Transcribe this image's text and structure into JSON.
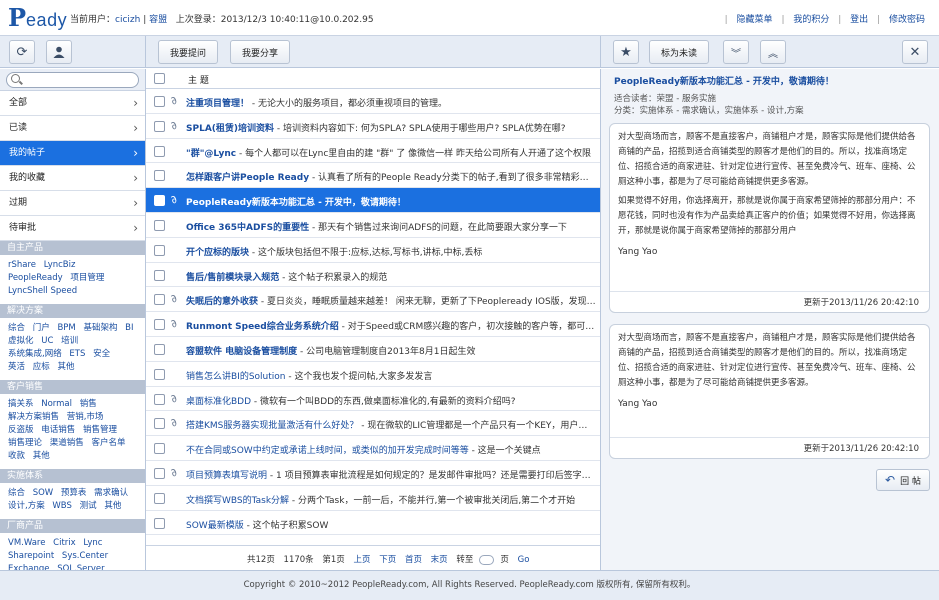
{
  "header": {
    "logo_p": "P",
    "logo_text": "eady",
    "current_user_label": "当前用户：",
    "user_name": "cicizh",
    "user_sep": " | ",
    "user_company": "容盟",
    "last_login_label": "上次登录：",
    "last_login_value": "2013/12/3 10:40:11@10.0.202.95",
    "links": [
      "隐藏菜单",
      "我的积分",
      "登出",
      "修改密码"
    ]
  },
  "toolbar": {
    "ask_label": "我要提问",
    "share_label": "我要分享",
    "mark_unread_label": "标为未读"
  },
  "sidebar": {
    "search_placeholder": "",
    "nav": [
      {
        "label": "全部"
      },
      {
        "label": "已读"
      },
      {
        "label": "我的帖子",
        "active": true
      },
      {
        "label": "我的收藏"
      },
      {
        "label": "过期"
      },
      {
        "label": "待审批"
      }
    ],
    "sections": [
      {
        "title": "自主产品",
        "items": [
          "rShare",
          "LyncBiz",
          "PeopleReady",
          "项目管理",
          "LyncShell Speed"
        ]
      },
      {
        "title": "解决方案",
        "items": [
          "综合",
          "门户",
          "BPM",
          "基础架构",
          "BI",
          "虚拟化",
          "UC",
          "培训",
          "系统集成,网络",
          "ETS",
          "安全",
          "英活",
          "应标",
          "其他"
        ]
      },
      {
        "title": "客户销售",
        "items": [
          "搞关系",
          "Normal",
          "销售",
          "解决方案销售",
          "营销,市场",
          "反盗版",
          "电话销售",
          "销售管理",
          "销售理论",
          "渠道销售",
          "客户名单",
          "收款",
          "其他"
        ]
      },
      {
        "title": "实施体系",
        "items": [
          "综合",
          "SOW",
          "预算表",
          "需求确认",
          "设计,方案",
          "WBS",
          "测试",
          "其他"
        ]
      },
      {
        "title": "厂商产品",
        "items": [
          "VM.Ware",
          "Citrix",
          "Lync",
          "Sharepoint",
          "Sys.Center",
          "Exchange",
          "SQL.Server",
          "Sophos",
          "Symantec",
          "Win.Server"
        ]
      }
    ]
  },
  "list": {
    "header_label": "主 题",
    "rows": [
      {
        "attach": true,
        "title": "注重项目管理！",
        "summary": " - 无论大小的服务项目，都必须重视项目的管理。"
      },
      {
        "attach": true,
        "title": "SPLA(租赁)培训资料",
        "summary": " - 培训资料内容如下: 何为SPLA? SPLA使用于哪些用户? SPLA优势在哪?"
      },
      {
        "attach": false,
        "title": "\"群\"@Lync",
        "summary": " - 每个人都可以在Lync里自由的建 \"群\" 了 像微信一样 昨天给公司所有人开通了这个权限"
      },
      {
        "attach": false,
        "title": "怎样跟客户讲People Ready",
        "summary": " - 认真看了所有的People Ready分类下的帖子,看到了很多非常精彩的功能说..."
      },
      {
        "attach": true,
        "title": "PeopleReady新版本功能汇总 - 开发中，敬请期待！",
        "summary": "",
        "selected": true
      },
      {
        "attach": false,
        "title": "Office 365中ADFS的重要性",
        "summary": " - 那天有个销售过来询问ADFS的问题，在此简要跟大家分享一下"
      },
      {
        "attach": false,
        "title": "开个应标的版块",
        "summary": " - 这个版块包括但不限于:应标,达标,写标书,讲标,中标,丢标"
      },
      {
        "attach": false,
        "title": "售后/售前模块录入规范",
        "summary": " - 这个帖子积累录入的规范"
      },
      {
        "attach": true,
        "title": "失眠后的意外收获",
        "summary": " - 夏日炎炎，睡眠质量越来越差！ 闲来无聊，更新了下Peopleready IOS版，发现功能..."
      },
      {
        "attach": true,
        "title": "Runmont Speed综合业务系统介绍",
        "summary": " - 对于Speed或CRM感兴趣的客户，初次接触的客户等，都可以发这..."
      },
      {
        "attach": false,
        "title": "容盟软件 电脑设备管理制度",
        "summary": " - 公司电脑管理制度自2013年8月1日起生效"
      },
      {
        "attach": false,
        "title": "销售怎么讲BI的Solution",
        "summary": " - 这个我也发个提问帖,大家多发发言",
        "plain": true
      },
      {
        "attach": true,
        "title": "桌面标准化BDD",
        "summary": " - 微软有一个叫BDD的东西,做桌面标准化的,有最新的资料介绍吗?",
        "plain": true
      },
      {
        "attach": true,
        "title": "搭建KMS服务器实现批量激活有什么好处？",
        "summary": " - 现在微软的LIC管理都是一个产品只有一个KEY，用户如果分...",
        "plain": true
      },
      {
        "attach": false,
        "title": "不在合同或SOW中约定或承诺上线时间，或类似的加开发完成时间等等",
        "summary": " - 这是一个关键点",
        "plain": true
      },
      {
        "attach": true,
        "title": "项目预算表填写说明",
        "summary": " - 1 项目预算表审批流程是如何规定的？是发邮件审批吗？还是需要打印后签字？发...",
        "plain": true
      },
      {
        "attach": false,
        "title": "文档撰写WBS的Task分解",
        "summary": " - 分两个Task，一前一后，不能并行,第一个被审批关闭后,第二个才开始",
        "plain": true
      },
      {
        "attach": false,
        "title": "SOW最新模版",
        "summary": " - 这个帖子积累SOW",
        "plain": true
      }
    ],
    "pager": {
      "total_pages": "共12页",
      "total_items": "1170条",
      "current": "第1页",
      "first": "上页",
      "next": "下页",
      "home": "首页",
      "last": "末页",
      "goto": "转至",
      "page_unit": "页",
      "go": "Go"
    }
  },
  "detail": {
    "title": "PeopleReady新版本功能汇总 - 开发中，敬请期待！",
    "audience": "适合读者：荣盟 - 服务实施",
    "category": "分类：实施体系 - 需求确认，实施体系 - 设计,方案",
    "cards": [
      {
        "p1": "对大型商场而言，顾客不是直接客户，商铺租户才是，顾客实际是他们提供给各商铺的产品，招揽到适合商铺类型的顾客才是他们的目的。所以，找准商场定位、招揽合适的商家进驻、针对定位进行宣传、甚至免费冷气、班车、座椅、公厕这种小事，都是为了尽可能给商铺提供更多客源。",
        "p2": "如果觉得不好用，你选择离开，那就是说你属于商家希望筛掉的那部分用户：不愿花钱，同时也没有作为产品卖给真正客户的价值；如果觉得不好用，你选择离开，那就是说你属于商家希望筛掉的那部分用户",
        "signature": "Yang Yao",
        "updated": "更新于2013/11/26 20:42:10"
      },
      {
        "p1": "对大型商场而言，顾客不是直接客户，商铺租户才是，顾客实际是他们提供给各商铺的产品，招揽到适合商铺类型的顾客才是他们的目的。所以，找准商场定位、招揽合适的商家进驻、针对定位进行宣传、甚至免费冷气、班车、座椅、公厕这种小事，都是为了尽可能给商铺提供更多客源。",
        "p2": "",
        "signature": "Yang Yao",
        "updated": "更新于2013/11/26 20:42:10"
      }
    ],
    "reply_label": "回 帖"
  },
  "footer": {
    "copyright": "Copyright © 2010~2012 PeopleReady.com, All Rights Reserved. PeopleReady.com 版权所有, 保留所有权利。"
  },
  "colors": {
    "accent": "#1b70e0",
    "link": "#1a4ea0",
    "toolbar_bg": "#e6ecf5"
  },
  "icons": [
    "refresh-icon",
    "user-icon",
    "star-icon",
    "chevron-down-double-icon",
    "chevron-up-double-icon",
    "close-icon",
    "paperclip-icon",
    "reply-arrow-icon",
    "search-icon"
  ]
}
